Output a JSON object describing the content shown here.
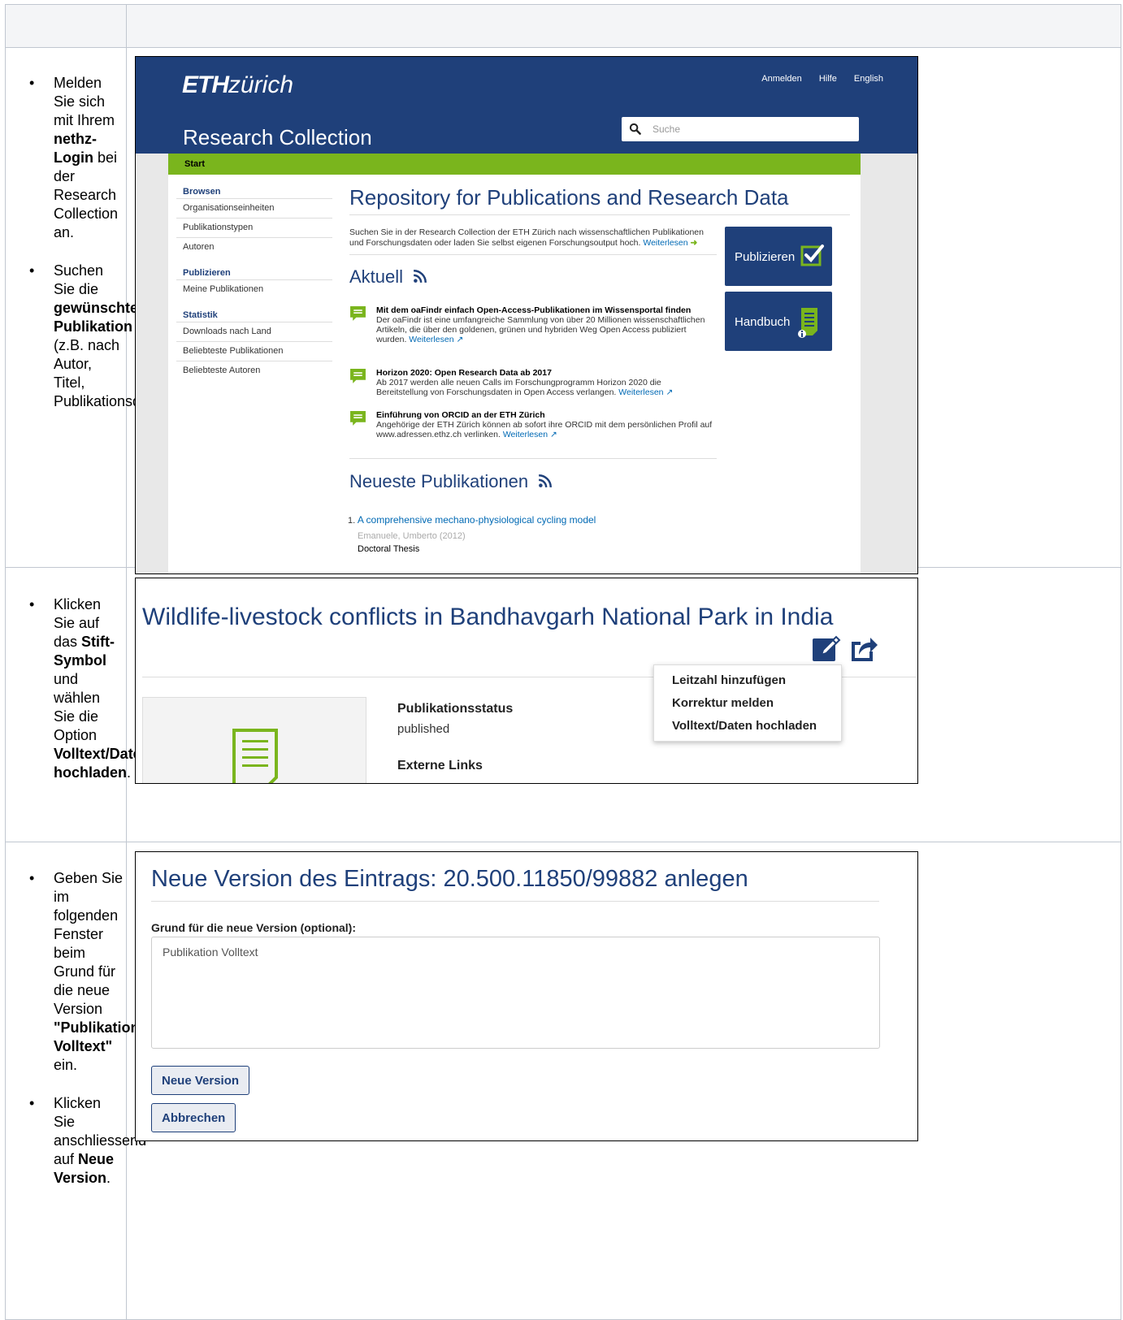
{
  "instructions": {
    "row1": {
      "bullet1": [
        "Melden Sie sich mit Ihrem ",
        "nethz-Login",
        " bei der Research Collection an."
      ],
      "bullet2": [
        "Suchen Sie die ",
        "gewünschte Publikation",
        " (z.B. nach Autor, Titel, Publikationsdatum)"
      ]
    },
    "row2": {
      "bullet1": [
        "Klicken Sie auf das ",
        "Stift-Symbol",
        " und wählen Sie die Option ",
        "Volltext/Daten hochladen",
        "."
      ]
    },
    "row3": {
      "bullet1": [
        "Geben Sie im folgenden Fenster beim Grund für die neue Version ",
        "\"Publikation Volltext\"",
        " ein."
      ],
      "bullet2": [
        "Klicken Sie anschliessend auf ",
        "Neue Version",
        "."
      ]
    }
  },
  "rc": {
    "logo_eth": "ETH",
    "logo_zurich": "zürich",
    "top_links": [
      "Anmelden",
      "Hilfe",
      "English"
    ],
    "title": "Research Collection",
    "search_placeholder": "Suche",
    "breadcrumb": "Start",
    "nav": {
      "browsen": "Browsen",
      "browsen_items": [
        "Organisationseinheiten",
        "Publikationstypen",
        "Autoren"
      ],
      "publizieren": "Publizieren",
      "publizieren_items": [
        "Meine Publikationen"
      ],
      "statistik": "Statistik",
      "statistik_items": [
        "Downloads nach Land",
        "Beliebteste Publikationen",
        "Beliebteste Autoren"
      ]
    },
    "heading": "Repository for Publications and Research Data",
    "intro": "Suchen Sie in der Research Collection der ETH Zürich nach wissenschaftlichen Publikationen und Forschungsdaten oder laden Sie selbst eigenen Forschungsoutput hoch.",
    "intro_link": "Weiterlesen",
    "aktuell": "Aktuell",
    "news": [
      {
        "title": "Mit dem oaFindr einfach Open-Access-Publikationen im Wissensportal finden",
        "text": "Der oaFindr ist eine umfangreiche Sammlung von über 20 Millionen wissenschaftlichen Artikeln, die über den goldenen, grünen und hybriden Weg Open Access publiziert wurden.",
        "link": "Weiterlesen"
      },
      {
        "title": "Horizon 2020: Open Research Data ab 2017",
        "text": "Ab 2017 werden alle neuen Calls im Forschungprogramm Horizon 2020 die Bereitstellung von Forschungsdaten in Open Access verlangen.",
        "link": "Weiterlesen"
      },
      {
        "title": "Einführung von ORCID an der ETH Zürich",
        "text": "Angehörige der ETH Zürich können ab sofort ihre ORCID mit dem persönlichen Profil auf www.adressen.ethz.ch verlinken.",
        "link": "Weiterlesen"
      }
    ],
    "neueste": "Neueste Publikationen",
    "pub_num": "1.",
    "pub_title": "A comprehensive mechano-physiological cycling model",
    "pub_meta": "Emanuele, Umberto (2012)",
    "pub_type": "Doctoral Thesis",
    "btn_publizieren": "Publizieren",
    "btn_handbuch": "Handbuch"
  },
  "wildlife": {
    "title": "Wildlife-livestock conflicts in Bandhavgarh National Park in India",
    "status_label": "Publikationsstatus",
    "status_value": "published",
    "links_label": "Externe Links",
    "menu": [
      "Leitzahl hinzufügen",
      "Korrektur melden",
      "Volltext/Daten hochladen"
    ]
  },
  "neue_version": {
    "title": "Neue Version des Eintrags: 20.500.11850/99882 anlegen",
    "reason_label": "Grund für die neue Version (optional):",
    "reason_value": "Publikation Volltext",
    "btn_new": "Neue Version",
    "btn_cancel": "Abbrechen"
  },
  "colors": {
    "eth_blue": "#1f407a",
    "eth_green": "#7ab51d",
    "link": "#0069b4"
  }
}
